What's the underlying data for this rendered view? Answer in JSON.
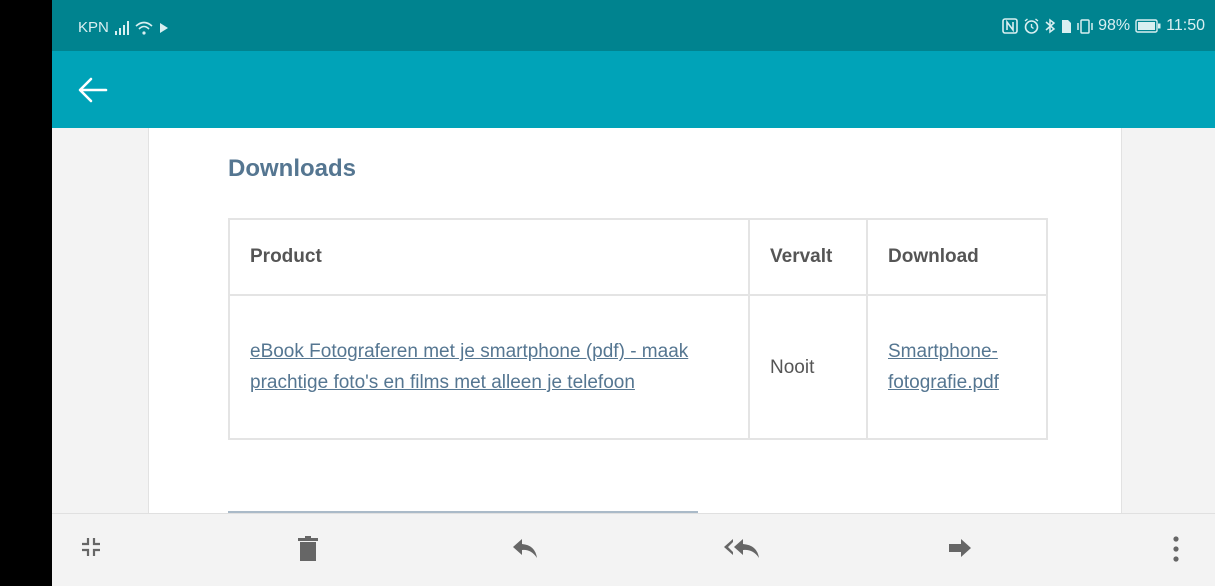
{
  "statusbar": {
    "carrier": "KPN",
    "battery_percent": "98%",
    "time": "11:50"
  },
  "appbar": {
    "back_icon": "arrow-left-icon"
  },
  "downloads": {
    "heading": "Downloads",
    "columns": [
      "Product",
      "Vervalt",
      "Download"
    ],
    "rows": [
      {
        "product": "eBook Fotograferen met je smartphone (pdf) - maak prachtige foto's en films met alleen je telefoon",
        "expires": "Nooit",
        "file": "Smartphone-fotografie.pdf"
      }
    ]
  },
  "bottombar": {
    "icons": [
      "collapse-icon",
      "trash-icon",
      "reply-icon",
      "reply-all-icon",
      "forward-icon",
      "more-vertical-icon"
    ]
  },
  "colors": {
    "statusbar": "#00838f",
    "appbar": "#00a3b8",
    "heading": "#557691"
  }
}
